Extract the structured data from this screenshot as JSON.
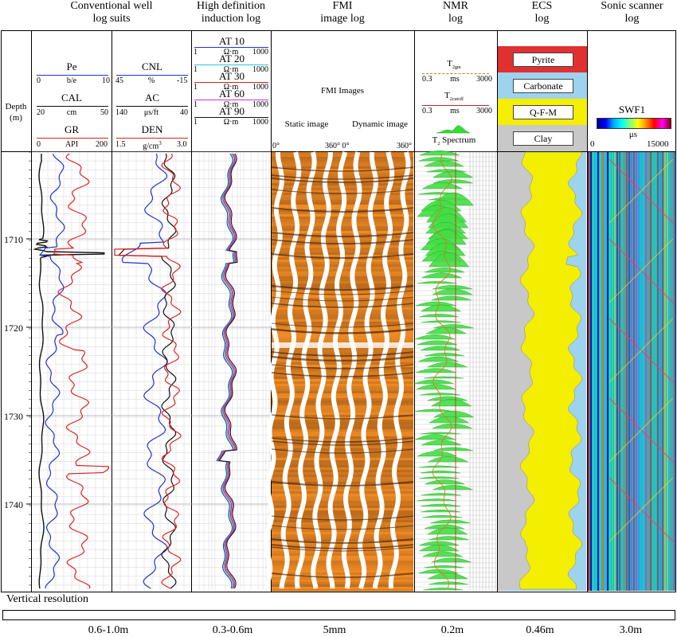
{
  "columns": {
    "conventional": "Conventional well\nlog suits",
    "induction": "High definition\ninduction log",
    "fmi": "FMI\nimage log",
    "nmr": "NMR\nlog",
    "ecs": "ECS\nlog",
    "sonic": "Sonic scanner\nlog"
  },
  "depth_header": {
    "label": "Depth",
    "unit": "(m)"
  },
  "depth_ticks": [
    "1710",
    "1720",
    "1730",
    "1740"
  ],
  "track1": {
    "pe": {
      "name": "Pe",
      "unit": "b/e",
      "min": "0",
      "max": "10",
      "color": "#2233cc"
    },
    "cal": {
      "name": "CAL",
      "unit": "cm",
      "min": "20",
      "max": "50",
      "color": "#111111"
    },
    "gr": {
      "name": "GR",
      "unit": "API",
      "min": "0",
      "max": "200",
      "color": "#dd2222"
    }
  },
  "track2": {
    "cnl": {
      "name": "CNL",
      "unit": "%",
      "min": "45",
      "max": "-15",
      "color": "#2233cc"
    },
    "ac": {
      "name": "AC",
      "unit": "μs/ft",
      "min": "140",
      "max": "40",
      "color": "#111111"
    },
    "den": {
      "name": "DEN",
      "unit": "g/cm",
      "unit_sup": "3",
      "min": "1.5",
      "max": "3.0",
      "color": "#dd2222"
    }
  },
  "track3": {
    "curves": [
      {
        "name": "AT 10",
        "color": "#2233cc"
      },
      {
        "name": "AT 20",
        "color": "#22cccc"
      },
      {
        "name": "AT 30",
        "color": "#cc2222"
      },
      {
        "name": "AT 60",
        "color": "#cc33cc"
      },
      {
        "name": "AT 90",
        "color": "#111111"
      }
    ],
    "unit": "Ω·m",
    "min": "1",
    "max": "1000"
  },
  "fmi": {
    "header": "FMI Images",
    "static": "Static image",
    "dynamic": "Dynamic image",
    "ticks": [
      "0°",
      "360° 0°",
      "360°"
    ]
  },
  "nmr": {
    "t2gm": {
      "name": "T",
      "sub": "2gm",
      "unit": "ms",
      "min": "0.3",
      "max": "3000",
      "color": "#dd7722"
    },
    "t2cutoff": {
      "name": "T",
      "sub": "2cutoff",
      "unit": "ms",
      "min": "0.3",
      "max": "3000",
      "color": "#cc2222"
    },
    "spectrum": {
      "name": "T",
      "sub": "2",
      "rest": " Spectrum",
      "color": "#33dd33"
    }
  },
  "ecs": {
    "items": [
      {
        "name": "Pyrite",
        "color": "#e03030"
      },
      {
        "name": "Carbonate",
        "color": "#9dd3ee"
      },
      {
        "name": "Q-F-M",
        "color": "#f4ee00"
      },
      {
        "name": "Clay",
        "color": "#c8c8c8"
      }
    ]
  },
  "sonic": {
    "name": "SWF1",
    "unit": "μs",
    "min": "0",
    "max": "15000"
  },
  "resolution": {
    "label": "Vertical resolution",
    "values": [
      "0.6-1.0m",
      "0.3-0.6m",
      "5mm",
      "0.2m",
      "0.46m",
      "3.0m"
    ]
  }
}
